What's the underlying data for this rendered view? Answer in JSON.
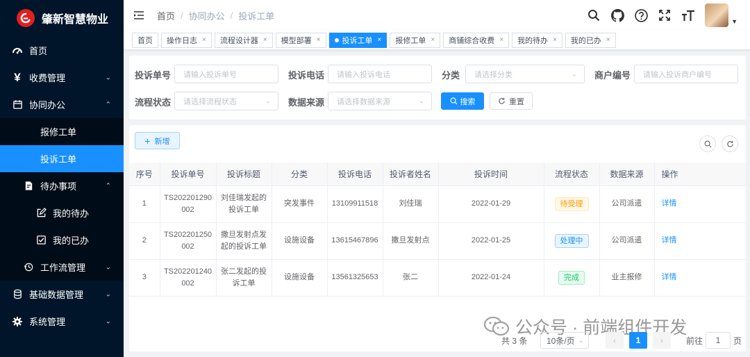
{
  "app": {
    "title": "肇新智慧物业"
  },
  "sidebar": {
    "items": [
      {
        "label": "首页",
        "icon": "dashboard-icon"
      },
      {
        "label": "收费管理",
        "icon": "yen-icon"
      },
      {
        "label": "协同办公",
        "icon": "calendar-icon"
      },
      {
        "label": "报修工单"
      },
      {
        "label": "投诉工单"
      },
      {
        "label": "待办事项",
        "icon": "todo-icon"
      },
      {
        "label": "我的待办",
        "icon": "edit-icon"
      },
      {
        "label": "我的已办",
        "icon": "checkbox-icon"
      },
      {
        "label": "工作流管理",
        "icon": "workflow-icon"
      },
      {
        "label": "基础数据管理",
        "icon": "database-icon"
      },
      {
        "label": "系统管理",
        "icon": "gear-icon"
      }
    ]
  },
  "header": {
    "breadcrumb": [
      "首页",
      "协同办公",
      "投诉工单"
    ]
  },
  "tags": [
    "首页",
    "操作日志",
    "流程设计器",
    "模型部署",
    "投诉工单",
    "报修工单",
    "商铺综合收费",
    "我的待办",
    "我的已办"
  ],
  "search": {
    "complaint_no_label": "投诉单号",
    "complaint_no_placeholder": "请输入投诉单号",
    "phone_label": "投诉电话",
    "phone_placeholder": "请输入投诉电话",
    "category_label": "分类",
    "category_placeholder": "请选择分类",
    "merchant_label": "商户编号",
    "merchant_placeholder": "请输入投诉商户编号",
    "flow_status_label": "流程状态",
    "flow_status_placeholder": "请选择流程状态",
    "source_label": "数据来源",
    "source_placeholder": "请选择数据来源",
    "search_button": "搜索",
    "reset_button": "重置"
  },
  "toolbar": {
    "add_button": "新增"
  },
  "table": {
    "columns": [
      "序号",
      "投诉单号",
      "投诉标题",
      "分类",
      "投诉电话",
      "投诉者姓名",
      "投诉时间",
      "流程状态",
      "数据来源",
      "操作"
    ],
    "rows": [
      {
        "index": "1",
        "no_a": "TS202201290",
        "no_b": "002",
        "title_a": "刘佳瑞发起的",
        "title_b": "投诉工单",
        "category": "突发事件",
        "phone": "13109911518",
        "name": "刘佳瑞",
        "time": "2022-01-29",
        "status": "待受理",
        "source": "公司派遣",
        "action": "详情"
      },
      {
        "index": "2",
        "no_a": "TS202201250",
        "no_b": "002",
        "title_a": "撒旦发射点发",
        "title_b": "起的投诉工单",
        "category": "设施设备",
        "phone": "13615467896",
        "name": "撒旦发射点",
        "time": "2022-01-25",
        "status": "处理中",
        "source": "公司派遣",
        "action": "详情"
      },
      {
        "index": "3",
        "no_a": "TS202201240",
        "no_b": "002",
        "title_a": "张二发起的投",
        "title_b": "诉工单",
        "category": "设施设备",
        "phone": "13561325653",
        "name": "张二",
        "time": "2022-01-24",
        "status": "完成",
        "source": "业主报修",
        "action": "详情"
      }
    ]
  },
  "pagination": {
    "total": "共 3 条",
    "page_size": "10条/页",
    "current_page": "1",
    "goto_label": "前往",
    "goto_value": "1",
    "page_suffix": "页"
  },
  "watermark": {
    "text": "公众号 · 前端组件开发"
  },
  "colors": {
    "primary": "#1890ff",
    "sidebar_bg": "#001529",
    "status_pending_bg": "#fff8e6",
    "status_pending_fg": "#ff9900",
    "status_processing_bg": "#e8f4ff",
    "status_processing_fg": "#1890ff",
    "status_done_bg": "#e7faf0",
    "status_done_fg": "#13ce66"
  }
}
